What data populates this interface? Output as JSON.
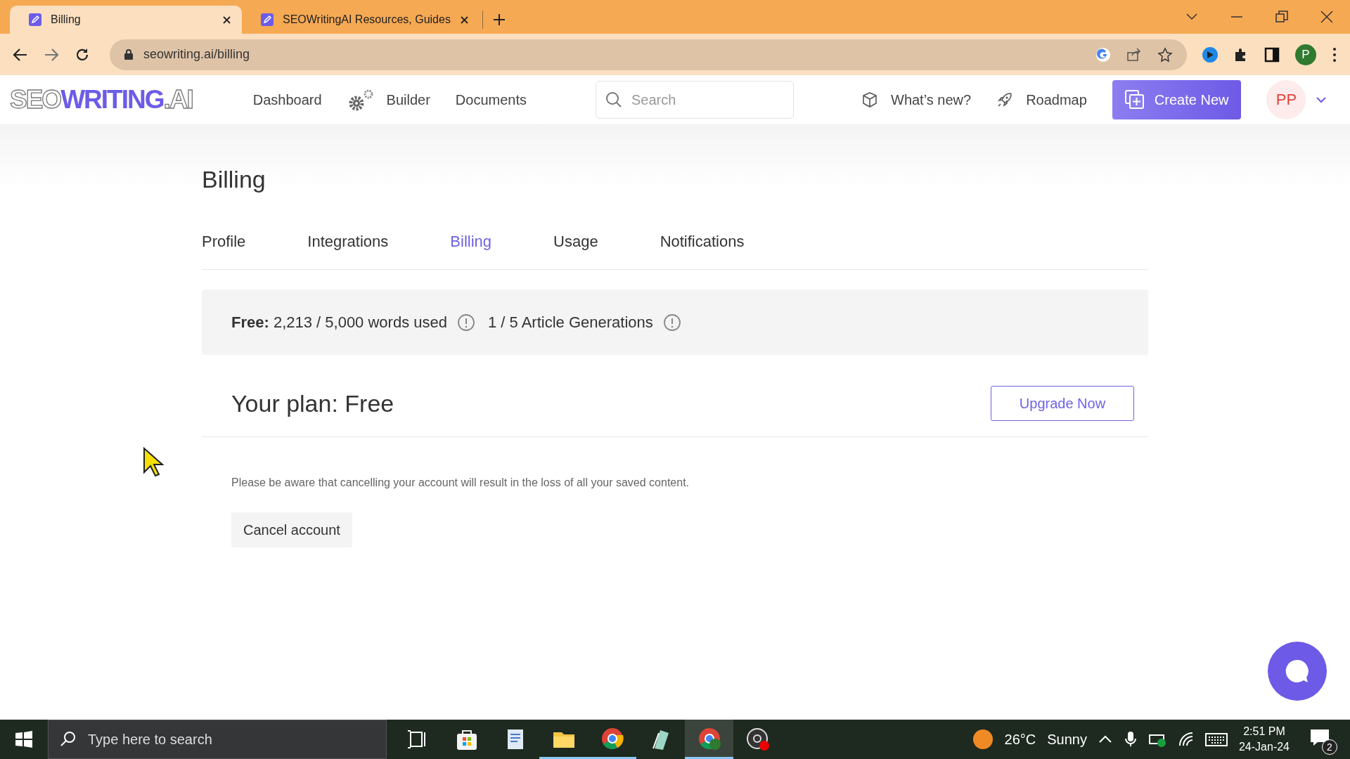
{
  "browser": {
    "tabs": [
      {
        "title": "Billing",
        "selected": true
      },
      {
        "title": "SEOWritingAI Resources, Guides",
        "selected": false
      }
    ],
    "url": "seowriting.ai/billing",
    "profile_initial": "P"
  },
  "header": {
    "logo": [
      "SEO",
      "WRITING",
      ".AI"
    ],
    "nav": [
      {
        "label": "Dashboard",
        "kind": "plain"
      },
      {
        "label": "Builder",
        "kind": "gear"
      },
      {
        "label": "Documents",
        "kind": "plain"
      }
    ],
    "search": {
      "placeholder": "Search"
    },
    "links": [
      {
        "label": "What’s new?",
        "kind": "box"
      },
      {
        "label": "Roadmap",
        "kind": "rocket"
      }
    ],
    "create_button": "Create New",
    "avatar": "PP"
  },
  "page": {
    "title": "Billing",
    "tabs": [
      {
        "label": "Profile",
        "selected": false
      },
      {
        "label": "Integrations",
        "selected": false
      },
      {
        "label": "Billing",
        "selected": true
      },
      {
        "label": "Usage",
        "selected": false
      },
      {
        "label": "Notifications",
        "selected": false
      }
    ],
    "usage": {
      "plan_label": "Free:",
      "words": "2,213 / 5,000 words used",
      "articles": "1 / 5 Article Generations"
    },
    "plan": "Your plan: Free",
    "upgrade_button": "Upgrade Now",
    "notice": "Please be aware that cancelling your account will result in the loss of all your saved content.",
    "cancel_button": "Cancel account"
  },
  "taskbar": {
    "search_placeholder": "Type here to search",
    "temperature": "26°C",
    "condition": "Sunny",
    "time": "2:51 PM",
    "date": "24-Jan-24",
    "notifications": "2"
  }
}
